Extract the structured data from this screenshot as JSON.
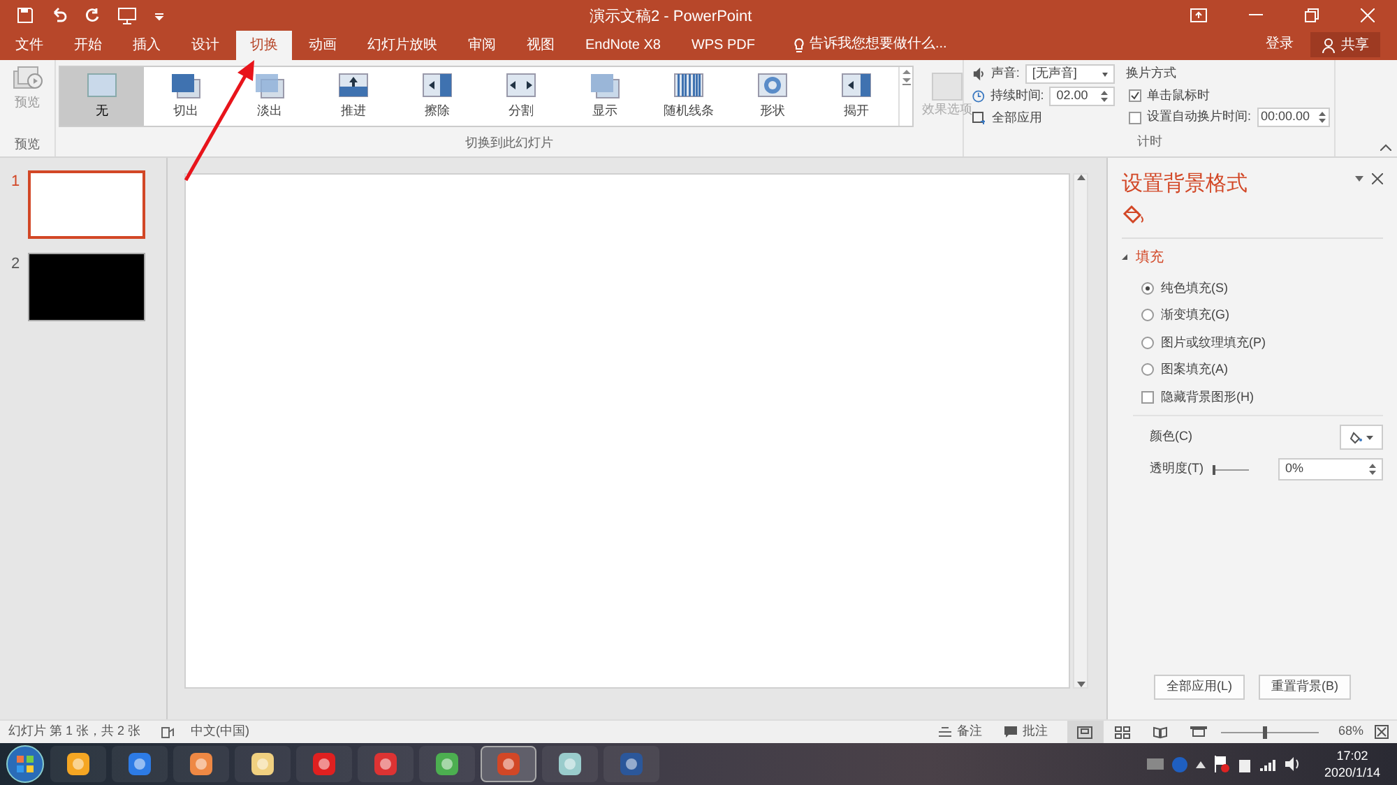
{
  "window": {
    "title": "演示文稿2 - PowerPoint",
    "sign_in": "登录",
    "share": "共享"
  },
  "tabs": [
    {
      "label": "文件",
      "selected": false
    },
    {
      "label": "开始",
      "selected": false
    },
    {
      "label": "插入",
      "selected": false
    },
    {
      "label": "设计",
      "selected": false
    },
    {
      "label": "切换",
      "selected": true
    },
    {
      "label": "动画",
      "selected": false
    },
    {
      "label": "幻灯片放映",
      "selected": false
    },
    {
      "label": "审阅",
      "selected": false
    },
    {
      "label": "视图",
      "selected": false
    },
    {
      "label": "EndNote X8",
      "selected": false
    },
    {
      "label": "WPS PDF",
      "selected": false
    }
  ],
  "tell_me": {
    "placeholder": "告诉我您想要做什么..."
  },
  "ribbon": {
    "preview": {
      "label": "预览",
      "group": "预览"
    },
    "transitions": [
      {
        "label": "无",
        "selected": true
      },
      {
        "label": "切出",
        "selected": false
      },
      {
        "label": "淡出",
        "selected": false
      },
      {
        "label": "推进",
        "selected": false
      },
      {
        "label": "擦除",
        "selected": false
      },
      {
        "label": "分割",
        "selected": false
      },
      {
        "label": "显示",
        "selected": false
      },
      {
        "label": "随机线条",
        "selected": false
      },
      {
        "label": "形状",
        "selected": false
      },
      {
        "label": "揭开",
        "selected": false
      }
    ],
    "effect_options": "效果选项",
    "transitions_group": "切换到此幻灯片",
    "sound": {
      "label": "声音:",
      "value": "[无声音]"
    },
    "duration": {
      "label": "持续时间:",
      "value": "02.00"
    },
    "apply_all": "全部应用",
    "advance_title": "换片方式",
    "on_click": {
      "label": "单击鼠标时",
      "checked": true
    },
    "after": {
      "label": "设置自动换片时间:",
      "checked": false,
      "value": "00:00.00"
    },
    "timing_group": "计时"
  },
  "slides": [
    {
      "number": "1",
      "selected": true,
      "color": "#ffffff"
    },
    {
      "number": "2",
      "selected": false,
      "color": "#000000"
    }
  ],
  "pane": {
    "title": "设置背景格式",
    "section": {
      "label": "填充",
      "expanded": true
    },
    "fill_options": [
      {
        "label": "纯色填充(S)",
        "selected": true
      },
      {
        "label": "渐变填充(G)",
        "selected": false
      },
      {
        "label": "图片或纹理填充(P)",
        "selected": false
      },
      {
        "label": "图案填充(A)",
        "selected": false
      }
    ],
    "hide_graphics": {
      "label": "隐藏背景图形(H)",
      "checked": false
    },
    "color_label": "颜色(C)",
    "transparency": {
      "label": "透明度(T)",
      "level": 0,
      "value": "0%"
    },
    "buttons": [
      "全部应用(L)",
      "重置背景(B)"
    ]
  },
  "status_bar": {
    "slide_info": "幻灯片 第 1 张，共 2 张",
    "language": "中文(中国)",
    "notes": "备注",
    "comments": "批注",
    "zoom": "68%",
    "zoom_slider": {
      "level": 0.45
    }
  },
  "taskbar": {
    "time": "17:02",
    "date": "2020/1/14"
  }
}
